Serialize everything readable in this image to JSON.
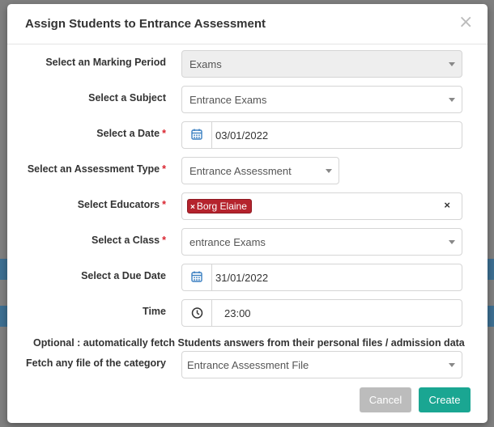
{
  "modal": {
    "title": "Assign Students to Entrance Assessment",
    "close_icon": "×"
  },
  "fields": {
    "marking_period": {
      "label": "Select an Marking Period",
      "value": "Exams",
      "required": false,
      "disabled": true
    },
    "subject": {
      "label": "Select a Subject",
      "value": "Entrance Exams",
      "required": false
    },
    "date": {
      "label": "Select a Date",
      "value": "03/01/2022",
      "required": true,
      "icon": "calendar-icon"
    },
    "assessment_type": {
      "label": "Select an Assessment Type",
      "value": "Entrance Assessment",
      "required": true
    },
    "educators": {
      "label": "Select Educators",
      "required": true,
      "tags": [
        "Borg Elaine"
      ],
      "tag_remove": "×",
      "clear": "×"
    },
    "class": {
      "label": "Select a Class",
      "value": "entrance Exams",
      "required": true
    },
    "due_date": {
      "label": "Select a Due Date",
      "value": "31/01/2022",
      "required": false,
      "icon": "calendar-icon"
    },
    "time": {
      "label": "Time",
      "value": "23:00",
      "required": false,
      "icon": "clock-icon"
    },
    "file_category": {
      "label": "Fetch any file of the category",
      "value": "Entrance Assessment File",
      "required": false
    }
  },
  "required_marker": "*",
  "optional_note": "Optional : automatically fetch Students answers from their personal files / admission data",
  "buttons": {
    "cancel": "Cancel",
    "create": "Create"
  },
  "colors": {
    "accent": "#1aa692",
    "tag": "#b5232d",
    "required": "#d9232e",
    "cancel": "#bcbcbc"
  }
}
